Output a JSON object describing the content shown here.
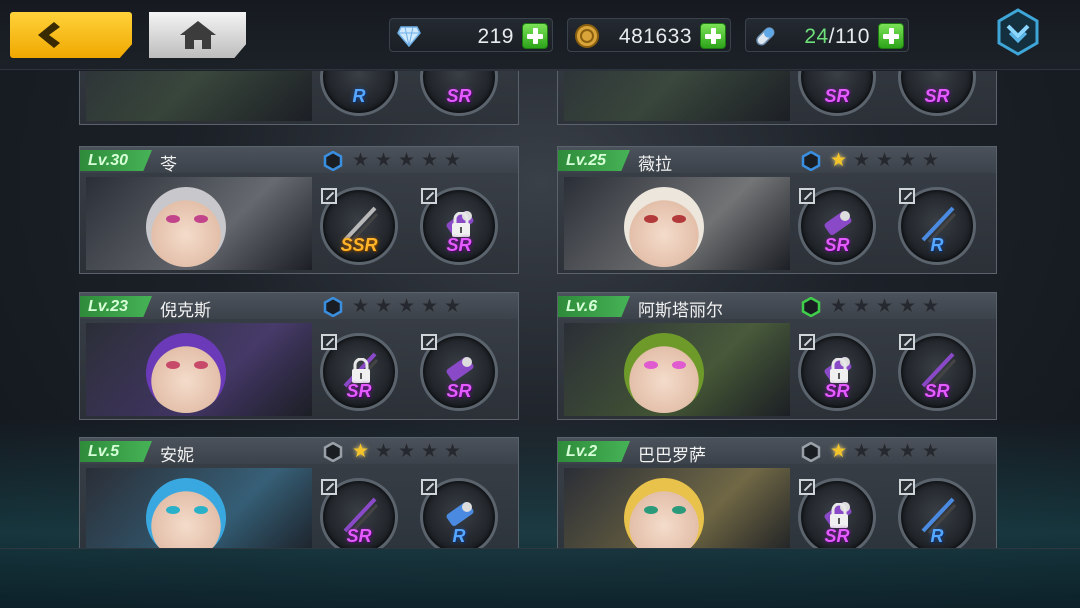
{
  "header": {
    "gems": "219",
    "gold": "481633",
    "stamina_current": "24",
    "stamina_max": "/110"
  },
  "top_cards": [
    {
      "tiers": [
        "R",
        "SR"
      ]
    },
    {
      "tiers": [
        "SR",
        "SR"
      ]
    }
  ],
  "cards": [
    {
      "level": "Lv.30",
      "name": "苓",
      "rank_color": "#3a8fe0",
      "stars": 0,
      "weapons": [
        {
          "tier": "SSR",
          "locked": false
        },
        {
          "tier": "SR",
          "locked": true
        }
      ],
      "hair": "#c8c8cc",
      "eye": "#c2448a"
    },
    {
      "level": "Lv.25",
      "name": "薇拉",
      "rank_color": "#3a8fe0",
      "stars": 1,
      "weapons": [
        {
          "tier": "SR",
          "locked": false
        },
        {
          "tier": "R",
          "locked": false
        }
      ],
      "hair": "#ece6dc",
      "eye": "#b33a3a"
    },
    {
      "level": "Lv.23",
      "name": "倪克斯",
      "rank_color": "#3a8fe0",
      "stars": 0,
      "weapons": [
        {
          "tier": "SR",
          "locked": true
        },
        {
          "tier": "SR",
          "locked": false
        }
      ],
      "hair": "#6a3ab8",
      "eye": "#c84a6a"
    },
    {
      "level": "Lv.6",
      "name": "阿斯塔丽尔",
      "rank_color": "#3fcf4a",
      "stars": 0,
      "weapons": [
        {
          "tier": "SR",
          "locked": true
        },
        {
          "tier": "SR",
          "locked": false
        }
      ],
      "hair": "#6e9a2a",
      "eye": "#e05ad0"
    },
    {
      "level": "Lv.5",
      "name": "安妮",
      "rank_color": "#9aa0a8",
      "stars": 1,
      "weapons": [
        {
          "tier": "SR",
          "locked": false
        },
        {
          "tier": "R",
          "locked": false
        }
      ],
      "hair": "#3aa8e0",
      "eye": "#2ab0c8"
    },
    {
      "level": "Lv.2",
      "name": "巴巴罗萨",
      "rank_color": "#9aa0a8",
      "stars": 1,
      "weapons": [
        {
          "tier": "SR",
          "locked": true
        },
        {
          "tier": "R",
          "locked": false
        }
      ],
      "hair": "#e8c24a",
      "eye": "#2a9a7a"
    }
  ],
  "icons": {
    "back": "chevron-left-icon",
    "home": "home-icon",
    "gem": "diamond-icon",
    "gold": "coin-icon",
    "stamina": "capsule-icon",
    "menu": "chevron-down-icon",
    "lock": "lock-icon",
    "slot": "slot-corner-icon",
    "star": "star-icon",
    "rank": "hexagon-icon"
  }
}
